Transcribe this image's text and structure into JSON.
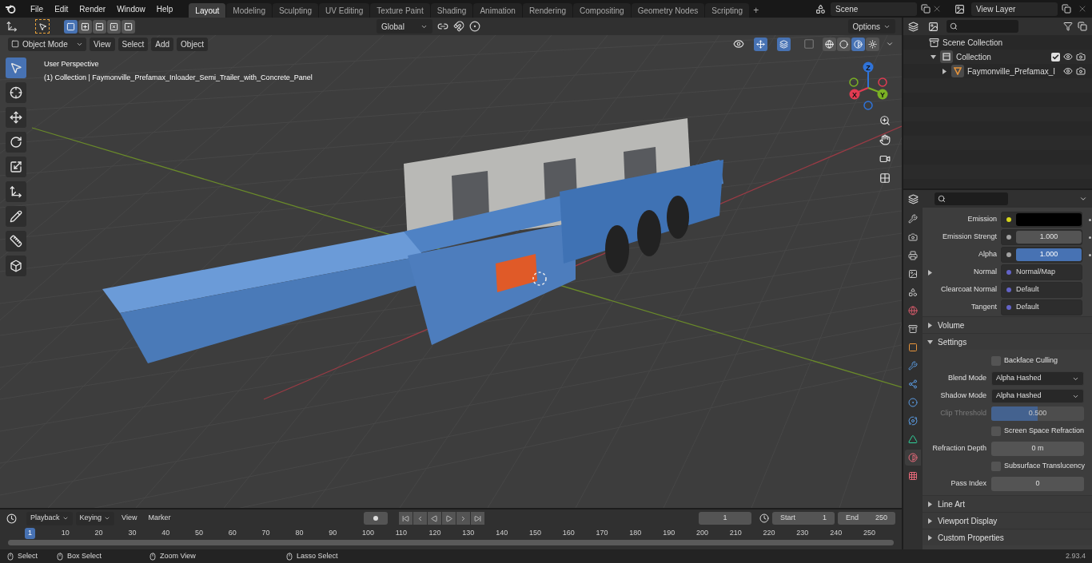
{
  "menu": [
    "File",
    "Edit",
    "Render",
    "Window",
    "Help"
  ],
  "workspaces": [
    {
      "label": "Layout",
      "selected": true
    },
    {
      "label": "Modeling",
      "selected": false
    },
    {
      "label": "Sculpting",
      "selected": false
    },
    {
      "label": "UV Editing",
      "selected": false
    },
    {
      "label": "Texture Paint",
      "selected": false
    },
    {
      "label": "Shading",
      "selected": false
    },
    {
      "label": "Animation",
      "selected": false
    },
    {
      "label": "Rendering",
      "selected": false
    },
    {
      "label": "Compositing",
      "selected": false
    },
    {
      "label": "Geometry Nodes",
      "selected": false
    },
    {
      "label": "Scripting",
      "selected": false
    }
  ],
  "add_workspace": "+",
  "scene": {
    "value": "Scene"
  },
  "view_layer": {
    "value": "View Layer"
  },
  "tool_header": {
    "select_modes": [
      {
        "kind": "new",
        "selected": true
      },
      {
        "kind": "extend",
        "selected": false
      },
      {
        "kind": "subtract",
        "selected": false
      },
      {
        "kind": "difference",
        "selected": false
      },
      {
        "kind": "intersect",
        "selected": false
      }
    ],
    "orientation": "Global",
    "options": "Options"
  },
  "viewport_header": {
    "mode": "Object Mode",
    "menus": [
      "View",
      "Select",
      "Add",
      "Object"
    ],
    "shading_modes": [
      {
        "kind": "wireframe",
        "selected": false
      },
      {
        "kind": "solid",
        "selected": false
      },
      {
        "kind": "material",
        "selected": true
      },
      {
        "kind": "rendered",
        "selected": false
      }
    ]
  },
  "viewport_overlay": {
    "title": "User Perspective",
    "subtitle": "(1) Collection | Faymonville_Prefamax_Inloader_Semi_Trailer_with_Concrete_Panel"
  },
  "gizmo_axes": [
    {
      "label": "Z",
      "color": "#2f73d9"
    },
    {
      "label": "Y",
      "color": "#7bb224"
    },
    {
      "label": "X",
      "color": "#e23b52"
    }
  ],
  "tools": [
    {
      "kind": "select",
      "selected": true
    },
    {
      "kind": "cursor",
      "selected": false
    },
    {
      "kind": "move",
      "selected": false
    },
    {
      "kind": "rotate",
      "selected": false
    },
    {
      "kind": "scale",
      "selected": false
    },
    {
      "kind": "transform",
      "selected": false
    },
    {
      "kind": "annotate",
      "selected": false
    },
    {
      "kind": "measure",
      "selected": false
    },
    {
      "kind": "add-cube",
      "selected": false
    }
  ],
  "outliner": {
    "items": [
      {
        "label": "Scene Collection",
        "kind": "scene",
        "children": [
          {
            "label": "Collection",
            "kind": "collection",
            "expanded": true,
            "checked": true,
            "children": [
              {
                "label": "Faymonville_Prefamax_I",
                "kind": "object",
                "expanded": false
              }
            ]
          }
        ]
      }
    ]
  },
  "properties": {
    "tabs": [
      {
        "kind": "tool",
        "selected": false
      },
      {
        "kind": "render",
        "selected": false
      },
      {
        "kind": "output",
        "selected": false
      },
      {
        "kind": "view-layer",
        "selected": false
      },
      {
        "kind": "scene",
        "selected": false
      },
      {
        "kind": "world",
        "selected": false
      },
      {
        "kind": "collection",
        "selected": false
      },
      {
        "kind": "object",
        "selected": false
      },
      {
        "kind": "modifiers",
        "selected": false
      },
      {
        "kind": "particles",
        "selected": false
      },
      {
        "kind": "physics",
        "selected": false
      },
      {
        "kind": "constraints",
        "selected": false
      },
      {
        "kind": "data",
        "selected": false
      },
      {
        "kind": "material",
        "selected": true
      },
      {
        "kind": "texture",
        "selected": false
      }
    ],
    "inputs": [
      {
        "label": "Emission",
        "kind": "swatch",
        "color": "#d6d61a"
      },
      {
        "label": "Emission Strengt",
        "kind": "value",
        "color": "#a1a1a1",
        "value": "1.000"
      },
      {
        "label": "Alpha",
        "kind": "slider",
        "color": "#a1a1a1",
        "value": "1.000",
        "level": 1
      },
      {
        "label": "Normal",
        "kind": "link",
        "color": "#6363c7",
        "value": "Normal/Map",
        "expanded": false
      },
      {
        "label": "Clearcoat Normal",
        "kind": "link",
        "color": "#6363c7",
        "value": "Default"
      },
      {
        "label": "Tangent",
        "kind": "link",
        "color": "#6363c7",
        "value": "Default"
      }
    ],
    "panels": [
      {
        "title": "Volume",
        "expanded": false
      },
      {
        "title": "Settings",
        "expanded": true,
        "rows": [
          {
            "kind": "checkbox",
            "label": "Backface Culling",
            "checked": false
          },
          {
            "kind": "dropdown",
            "label": "Blend Mode",
            "value": "Alpha Hashed"
          },
          {
            "kind": "dropdown",
            "label": "Shadow Mode",
            "value": "Alpha Hashed"
          },
          {
            "kind": "slider",
            "label": "Clip Threshold",
            "value": "0.500",
            "level": 0.5,
            "disabled": true
          },
          {
            "kind": "checkbox",
            "label": "Screen Space Refraction",
            "checked": false
          },
          {
            "kind": "number",
            "label": "Refraction Depth",
            "value": "0 m"
          },
          {
            "kind": "checkbox",
            "label": "Subsurface Translucency",
            "checked": false
          },
          {
            "kind": "number",
            "label": "Pass Index",
            "value": "0"
          }
        ]
      },
      {
        "title": "Line Art",
        "expanded": false
      },
      {
        "title": "Viewport Display",
        "expanded": false
      },
      {
        "title": "Custom Properties",
        "expanded": false
      }
    ]
  },
  "timeline": {
    "menus": [
      "Playback",
      "Keying",
      "View",
      "Marker"
    ],
    "current_frame": "1",
    "start_label": "Start",
    "start": "1",
    "end_label": "End",
    "end": "250",
    "ticks": [
      {
        "label": "1",
        "selected": true
      },
      {
        "label": "10",
        "selected": false
      },
      {
        "label": "20",
        "selected": false
      },
      {
        "label": "30",
        "selected": false
      },
      {
        "label": "40",
        "selected": false
      },
      {
        "label": "50",
        "selected": false
      },
      {
        "label": "60",
        "selected": false
      },
      {
        "label": "70",
        "selected": false
      },
      {
        "label": "80",
        "selected": false
      },
      {
        "label": "90",
        "selected": false
      },
      {
        "label": "100",
        "selected": false
      },
      {
        "label": "110",
        "selected": false
      },
      {
        "label": "120",
        "selected": false
      },
      {
        "label": "130",
        "selected": false
      },
      {
        "label": "140",
        "selected": false
      },
      {
        "label": "150",
        "selected": false
      },
      {
        "label": "160",
        "selected": false
      },
      {
        "label": "170",
        "selected": false
      },
      {
        "label": "180",
        "selected": false
      },
      {
        "label": "190",
        "selected": false
      },
      {
        "label": "200",
        "selected": false
      },
      {
        "label": "210",
        "selected": false
      },
      {
        "label": "220",
        "selected": false
      },
      {
        "label": "230",
        "selected": false
      },
      {
        "label": "240",
        "selected": false
      },
      {
        "label": "250",
        "selected": false
      }
    ]
  },
  "status_bar": {
    "hints": [
      "Select",
      "Box Select",
      "Zoom View",
      "Lasso Select"
    ],
    "version": "2.93.4"
  }
}
